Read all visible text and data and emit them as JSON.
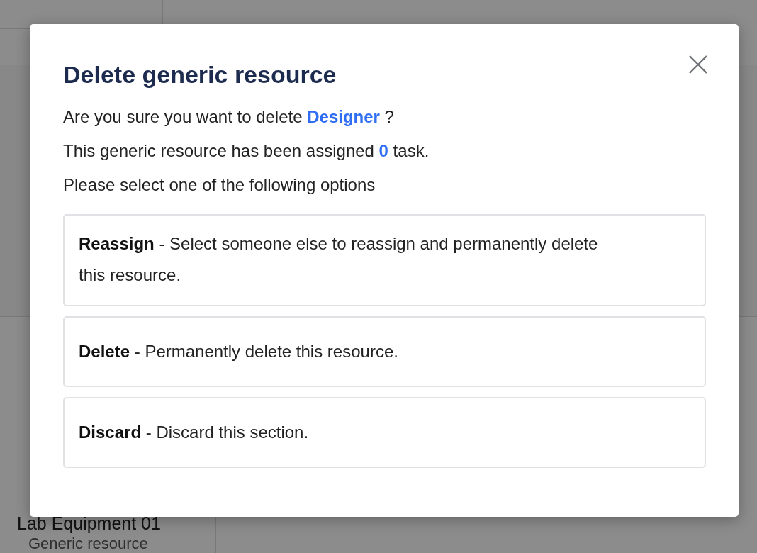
{
  "background": {
    "items": [
      {
        "title": "Lab Equipment 01",
        "subtitle": "Generic resource"
      }
    ]
  },
  "dialog": {
    "title": "Delete generic resource",
    "lines": [
      "Are you sure you want to delete **Designer** ?",
      "This generic resource has been assigned **0** task.",
      "Please select one of the following options"
    ],
    "options": [
      {
        "text": "**Reassign** - Select someone else to reassign and permanently delete this resource."
      },
      {
        "text": "**Delete** - Permanently delete this resource."
      },
      {
        "text": "**Discard** - Discard this section."
      }
    ]
  }
}
